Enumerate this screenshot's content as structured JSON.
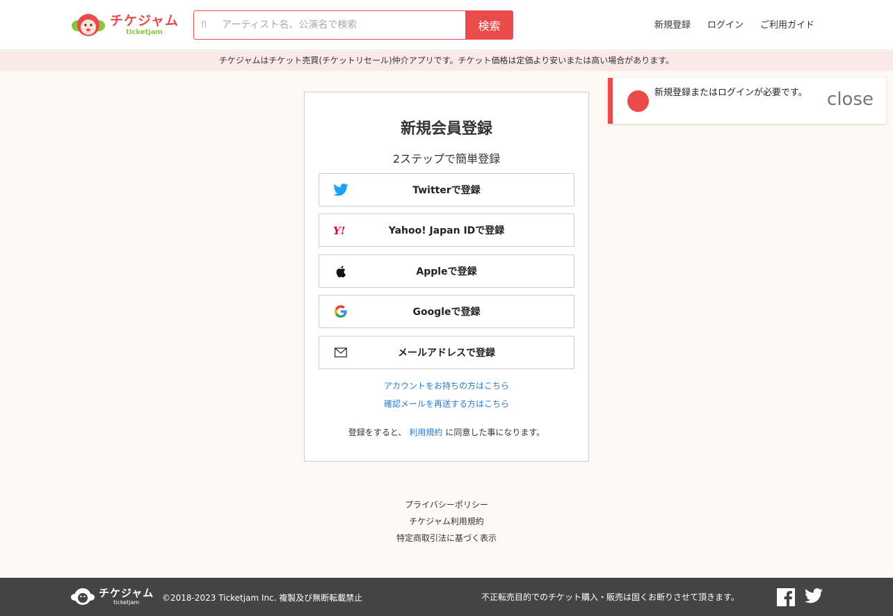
{
  "header": {
    "logo_jp": "チケジャム",
    "logo_en": "ticketjam",
    "search_icon": "fl",
    "search_placeholder": "アーティスト名、公演名で検索",
    "search_button": "検索",
    "nav": [
      "新規登録",
      "ログイン",
      "ご利用ガイド"
    ]
  },
  "notice": "チケジャムはチケット売買(チケットリセール)仲介アプリです。チケット価格は定価より安いまたは高い場合があります。",
  "card": {
    "title": "新規会員登録",
    "subtitle": "2ステップで簡単登録",
    "buttons": [
      {
        "label": "Twitterで登録",
        "icon": "twitter-icon"
      },
      {
        "label": "Yahoo! Japan IDで登録",
        "icon": "yahoo-icon"
      },
      {
        "label": "Appleで登録",
        "icon": "apple-icon"
      },
      {
        "label": "Googleで登録",
        "icon": "google-icon"
      },
      {
        "label": "メールアドレスで登録",
        "icon": "mail-icon"
      }
    ],
    "link_login": "アカウントをお持ちの方はこちら",
    "link_resend": "確認メールを再送する方はこちら",
    "agree_pre": "登録をすると、",
    "agree_link": "利用規約",
    "agree_post": "に同意した事になります。"
  },
  "toast": {
    "icon": "",
    "message": "新規登録またはログインが必要です。",
    "close": "close"
  },
  "footer_links": [
    "プライバシーポリシー",
    "チケジャム利用規約",
    "特定商取引法に基づく表示"
  ],
  "footer": {
    "logo_jp": "チケジャム",
    "logo_en": "ticketjam",
    "copyright": "©2018-2023 Ticketjam Inc. 複製及び無断転載禁止",
    "note": "不正転売目的でのチケット購入・販売は固くお断りさせて頂きます。"
  },
  "colors": {
    "accent": "#e94a4a",
    "link": "#2b7bd0",
    "notice_bg": "#fbe9e7",
    "footer_bg": "#444444"
  }
}
